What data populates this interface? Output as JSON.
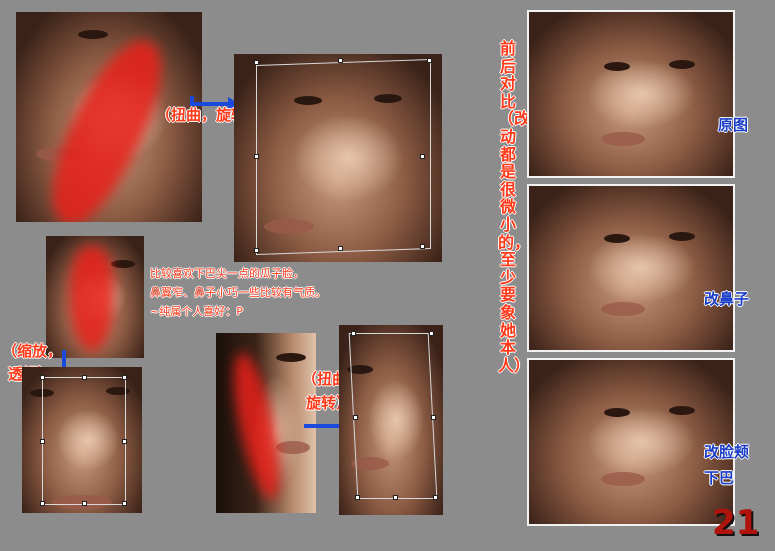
{
  "labels": {
    "distort_rotate_1": "（扭曲，旋转）",
    "scale_perspective_1": "（缩放，",
    "scale_perspective_2": "透视）",
    "distort_rotate_2a": "（扭曲，",
    "distort_rotate_2b": "旋转）"
  },
  "note": {
    "line1": "比较喜欢下巴尖一点的瓜子脸，",
    "line2": "鼻翼窄、鼻子小巧一些比较有气质。",
    "line3": "~纯属个人喜好：P"
  },
  "comparison": {
    "vertical_text": "前后对比（改动都是很微小的，至少要象她本人）",
    "original": "原图",
    "nose": "改鼻子",
    "cheek_1": "改脸颊",
    "cheek_2": "下巴"
  },
  "page_number": "21",
  "colors": {
    "background": "#8c8c8c",
    "annotation_red": "#ff3a1a",
    "label_blue": "#1a3cc8",
    "arrow_blue": "#1a4adc",
    "page_number": "#b0120c"
  }
}
